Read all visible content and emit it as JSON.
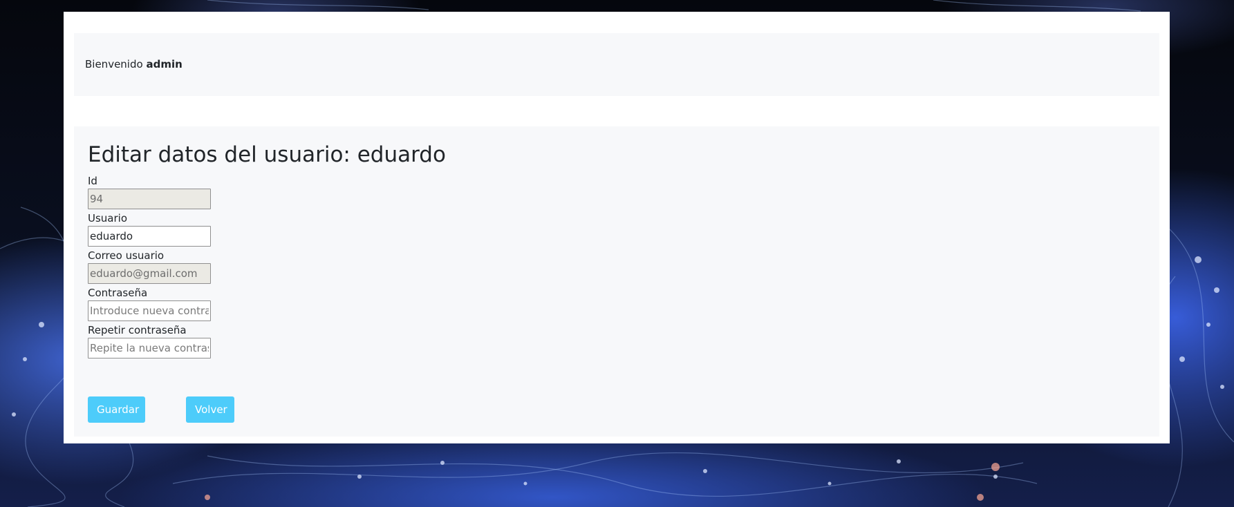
{
  "welcome": {
    "prefix": "Bienvenido",
    "username": "admin"
  },
  "form": {
    "title": "Editar datos del usuario: eduardo",
    "fields": [
      {
        "label": "Id",
        "value": "94",
        "placeholder": "",
        "readonly": true
      },
      {
        "label": "Usuario",
        "value": "eduardo",
        "placeholder": "",
        "readonly": false
      },
      {
        "label": "Correo usuario",
        "value": "eduardo@gmail.com",
        "placeholder": "",
        "readonly": true
      },
      {
        "label": "Contraseña",
        "value": "",
        "placeholder": "Introduce nueva contraseña",
        "readonly": false
      },
      {
        "label": "Repetir contraseña",
        "value": "",
        "placeholder": "Repite la nueva contraseña",
        "readonly": false
      }
    ],
    "buttons": {
      "save_label": "Guardar",
      "back_label": "Volver"
    }
  },
  "colors": {
    "button": "#4dccfa",
    "panel": "#f7f8fa",
    "card": "#ffffff",
    "readonly_input": "#ebeae4"
  }
}
